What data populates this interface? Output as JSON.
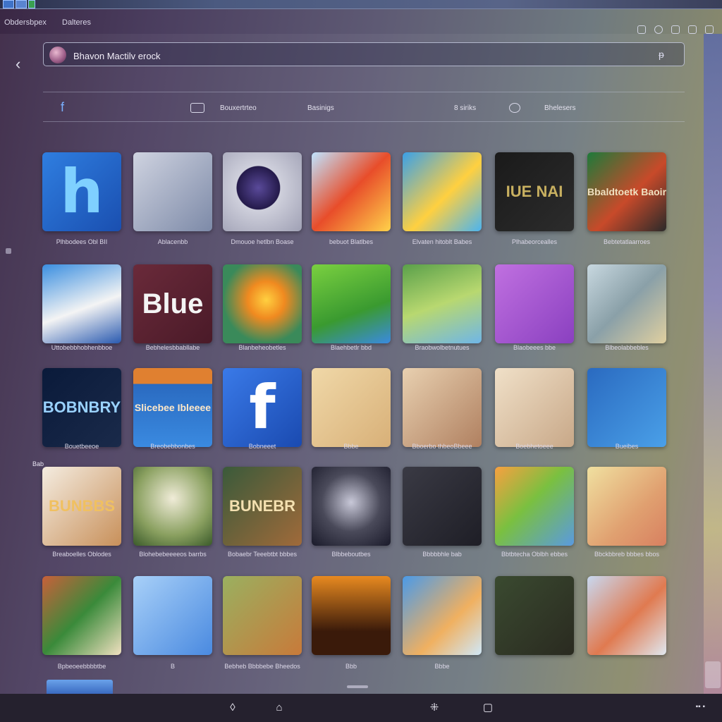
{
  "window": {
    "left_title": "Obdersbpex",
    "right_title": "Dalteres"
  },
  "search": {
    "value": "Bhavon Mactilv erock"
  },
  "tabs": [
    {
      "label": "Bouxertrteo"
    },
    {
      "label": "Basinigs"
    },
    {
      "label": "8 siriks"
    },
    {
      "label": "Bhelesers"
    }
  ],
  "section_label": "Bab",
  "apps": [
    {
      "caption": "Plhbodees Obl BII",
      "art": "h",
      "art_color": "#7fd0ff"
    },
    {
      "caption": "Ablacenbb",
      "art": "",
      "art_color": ""
    },
    {
      "caption": "Dmouoe hetlbn Boase",
      "art": "",
      "art_color": ""
    },
    {
      "caption": "bebuot Blatlbes",
      "art": "",
      "art_color": ""
    },
    {
      "caption": "Elvaten hitoblt Babes",
      "art": "",
      "art_color": ""
    },
    {
      "caption": "Plhabeorcealles",
      "art": "IUE NAI",
      "art_color": "#c8b060"
    },
    {
      "caption": "Bebtetatlaarroes",
      "art": "Bbaldtoetk Baoir",
      "art_color": "#f0e0c0"
    },
    {
      "caption": "Uttobebbhobhenbboe",
      "art": "",
      "art_color": ""
    },
    {
      "caption": "Bebhelesbbabllabe",
      "art": "Blue",
      "art_color": "#f4f4f4"
    },
    {
      "caption": "Blanbeheobetles",
      "art": "",
      "art_color": ""
    },
    {
      "caption": "Blaehbetlr bbd",
      "art": "",
      "art_color": ""
    },
    {
      "caption": "Braobwolbetnutues",
      "art": "",
      "art_color": ""
    },
    {
      "caption": "Blaobeees bbe",
      "art": "",
      "art_color": ""
    },
    {
      "caption": "Blbeolabbebles",
      "art": "",
      "art_color": ""
    },
    {
      "caption": "Bouetbeeoe",
      "art": "BOBNBRY",
      "art_color": "#9ad2ff"
    },
    {
      "caption": "Breobebbonbes",
      "art": "Slicebee Ibleeee",
      "art_color": "#ffe8c8"
    },
    {
      "caption": "Bobneeet",
      "art": "f",
      "art_color": "#ffffff"
    },
    {
      "caption": "Bbbe",
      "art": "",
      "art_color": ""
    },
    {
      "caption": "Bboerbo thbeoBbeee",
      "art": "",
      "art_color": ""
    },
    {
      "caption": "Boebhetoeee",
      "art": "",
      "art_color": ""
    },
    {
      "caption": "Bueibes",
      "art": "",
      "art_color": ""
    },
    {
      "caption": "Breaboelles Oblodes",
      "art": "BUNBBS",
      "art_color": "#f0c060"
    },
    {
      "caption": "Blohebebeeeeos barrbs",
      "art": "",
      "art_color": ""
    },
    {
      "caption": "Bobaebr Teeebtbt bbbes",
      "art": "BUNEBR",
      "art_color": "#f4e0b0"
    },
    {
      "caption": "Blbbeboutbes",
      "art": "",
      "art_color": ""
    },
    {
      "caption": "Bbbbbhle bab",
      "art": "",
      "art_color": ""
    },
    {
      "caption": "Bbtbtecha Oblbh ebbes",
      "art": "",
      "art_color": ""
    },
    {
      "caption": "Bbckbbreb bbbes bbos",
      "art": "",
      "art_color": ""
    },
    {
      "caption": "Bpbeoeebbbbtbe",
      "art": "",
      "art_color": ""
    },
    {
      "caption": "B",
      "art": "",
      "art_color": ""
    },
    {
      "caption": "Bebheb Bbbbebe Bheedos",
      "art": "",
      "art_color": ""
    },
    {
      "caption": "Bbb",
      "art": "",
      "art_color": ""
    },
    {
      "caption": "Bbbe",
      "art": "",
      "art_color": ""
    },
    {
      "caption": "",
      "art": "",
      "art_color": ""
    },
    {
      "caption": "",
      "art": "",
      "art_color": ""
    }
  ],
  "tile_backgrounds": [
    "linear-gradient(135deg,#2f7ee0,#1a4fb0)",
    "linear-gradient(135deg,#cfd3e0,#7d8aa8)",
    "radial-gradient(circle at 45% 45%,#5a4a9a 0,#241a4a 35%,#cfd0dc 36%,#9fa0b4 100%)",
    "linear-gradient(135deg,#bfe4ff,#e84d2a 50%,#ffd24a)",
    "linear-gradient(135deg,#3aa0e8,#ffd040 55%,#4bb4f0)",
    "linear-gradient(135deg,#1a1a1a,#2c2c2c)",
    "linear-gradient(135deg,#1d7a3a,#c84a2a 55%,#2a2a2a)",
    "linear-gradient(160deg,#3a8ee0,#f4f4f4 55%,#2a5ab0)",
    "linear-gradient(135deg,#6a2a3a,#4a1a28)",
    "radial-gradient(circle at 55% 45%,#ffd040 0,#f08a20 30%,#3a8a5a 70%)",
    "linear-gradient(160deg,#7ad040,#3a9a30 60%,#3a8ae0)",
    "linear-gradient(160deg,#5aa04a,#b8d870 50%,#6fb6e8)",
    "linear-gradient(135deg,#c070e0,#8a40c0)",
    "linear-gradient(135deg,#c8d8e0,#8aa0a8 50%,#e0d0a0)",
    "linear-gradient(135deg,#0a1a3a,#1a2a4a)",
    "linear-gradient(180deg,#e08030 0,#e08030 20%,#2a6ac0 20%,#3a8ae0 100%)",
    "linear-gradient(135deg,#3a7ae8,#1a4ab0)",
    "linear-gradient(135deg,#f0d8a8,#d8b078)",
    "linear-gradient(135deg,#e8d0b0,#b08060)",
    "linear-gradient(135deg,#f0e0c8,#c8a888)",
    "linear-gradient(135deg,#2a6ac0,#4aa0e8)",
    "linear-gradient(135deg,#f4ece0,#c8905a)",
    "radial-gradient(circle at 50% 40%,#f0ecd8 0,#8aa060 60%,#3a5a2a)",
    "linear-gradient(135deg,#3a5a3a,#a06a3a)",
    "radial-gradient(circle at 50% 45%,#c8c8d8 0,#4a4a5a 50%,#1a1a2a)",
    "linear-gradient(135deg,#3a3a44,#1e1e26)",
    "linear-gradient(135deg,#f8a040,#7ac040 45%,#5a9ae0)",
    "linear-gradient(135deg,#f0e0a0,#e0a070 60%,#d88060)",
    "linear-gradient(135deg,#c8603a,#3a8a3a 50%,#f0e0c0)",
    "linear-gradient(135deg,#a8d0f8,#4a8ae0)",
    "linear-gradient(135deg,#9ab060,#c87a3a)",
    "linear-gradient(180deg,#e88a20,#3a1a0a 70%)",
    "linear-gradient(135deg,#4a9ae8,#f0b060 60%,#d0e8f8)",
    "linear-gradient(135deg,#3a4a30,#2a2a20)",
    "linear-gradient(135deg,#c8d8f0,#e07a50 55%,#e0e8f0)"
  ]
}
